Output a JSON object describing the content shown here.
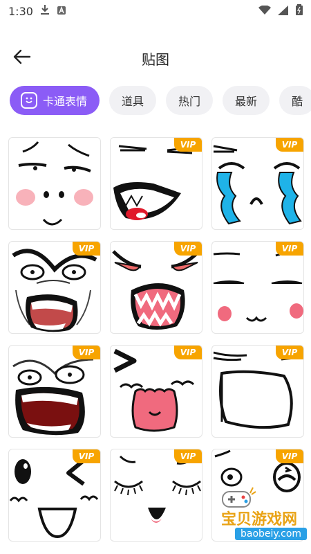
{
  "status_bar": {
    "time": "1:30"
  },
  "header": {
    "title": "贴图"
  },
  "tabs": [
    {
      "label": "卡通表情"
    },
    {
      "label": "道具"
    },
    {
      "label": "热门"
    },
    {
      "label": "最新"
    },
    {
      "label": "酷"
    }
  ],
  "vip_label": "VIP",
  "stickers": [
    {
      "name": "smirk-face",
      "vip": false
    },
    {
      "name": "laughing-face",
      "vip": true
    },
    {
      "name": "crying-face",
      "vip": true
    },
    {
      "name": "rage-face",
      "vip": true
    },
    {
      "name": "angry-teeth-face",
      "vip": true
    },
    {
      "name": "blushing-smile-face",
      "vip": true
    },
    {
      "name": "screaming-rage-face",
      "vip": true
    },
    {
      "name": "happy-squint-face",
      "vip": true
    },
    {
      "name": "shouting-face",
      "vip": true
    },
    {
      "name": "wink-face",
      "vip": true
    },
    {
      "name": "sleepy-happy-face",
      "vip": true
    },
    {
      "name": "shocked-face",
      "vip": true
    }
  ],
  "watermark": {
    "text": "宝贝游戏网",
    "url": "baobeiy.com"
  },
  "colors": {
    "accent": "#8b5cf6",
    "vip": "#f7a400",
    "blush": "#f06a7e",
    "tear": "#1fb3e8"
  }
}
